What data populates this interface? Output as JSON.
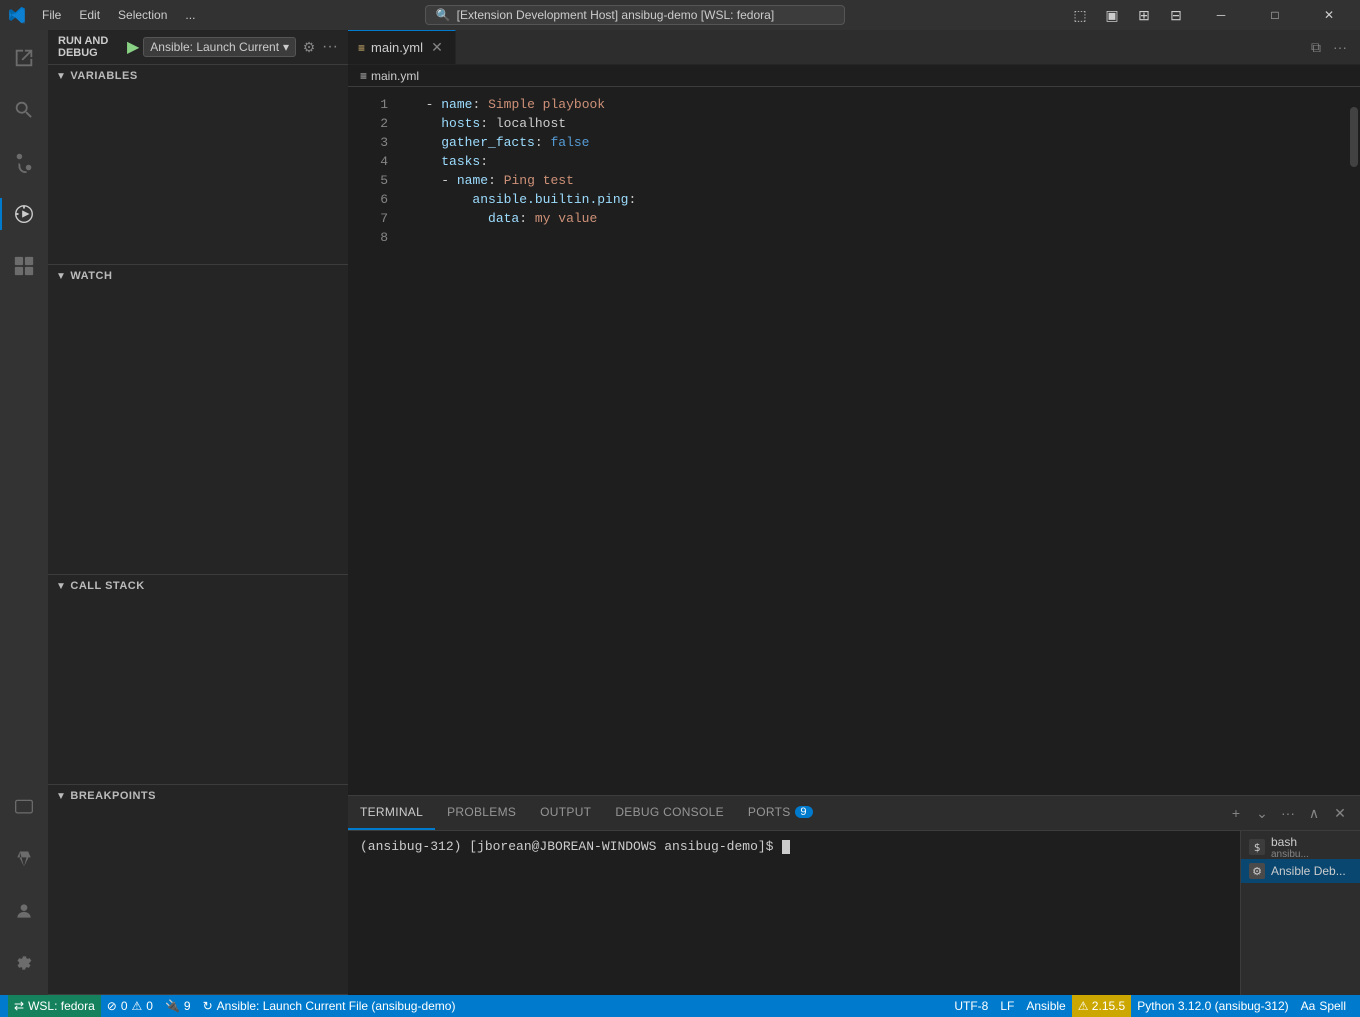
{
  "titlebar": {
    "menu_items": [
      "File",
      "Edit",
      "Selection",
      "..."
    ],
    "search_text": "[Extension Development Host] ansibug-demo [WSL: fedora]",
    "win_minimize": "─",
    "win_restore": "□",
    "win_close": "✕"
  },
  "activitybar": {
    "items": [
      {
        "name": "explorer",
        "icon": "⎘",
        "label": "Explorer"
      },
      {
        "name": "search",
        "icon": "🔍",
        "label": "Search"
      },
      {
        "name": "source-control",
        "icon": "⎇",
        "label": "Source Control"
      },
      {
        "name": "run-debug",
        "icon": "▶",
        "label": "Run and Debug",
        "active": true
      },
      {
        "name": "extensions",
        "icon": "⊞",
        "label": "Extensions"
      }
    ],
    "bottom_items": [
      {
        "name": "remote-explorer",
        "icon": "🖥",
        "label": "Remote Explorer"
      },
      {
        "name": "testing",
        "icon": "⚗",
        "label": "Testing"
      },
      {
        "name": "account",
        "icon": "A",
        "label": "Account"
      },
      {
        "name": "settings",
        "icon": "⚙",
        "label": "Settings"
      }
    ]
  },
  "sidebar": {
    "header": {
      "title": "RUN AND DEBUG",
      "run_icon": "▶",
      "config_label": "Ansible: Launch Current",
      "config_dropdown": "▾",
      "gear_icon": "⚙",
      "more_icon": "···"
    },
    "sections": {
      "variables": {
        "label": "VARIABLES",
        "expanded": true
      },
      "watch": {
        "label": "WATCH",
        "expanded": true
      },
      "call_stack": {
        "label": "CALL STACK",
        "expanded": true
      },
      "breakpoints": {
        "label": "BREAKPOINTS",
        "expanded": true
      }
    }
  },
  "editor": {
    "tab_icon": "≡",
    "tab_label": "main.yml",
    "tab_close": "✕",
    "breadcrumb_icon": "≡",
    "breadcrumb_label": "main.yml",
    "lines": [
      {
        "num": "1",
        "content": "  - name: Simple playbook"
      },
      {
        "num": "2",
        "content": "    hosts: localhost"
      },
      {
        "num": "3",
        "content": "    gather_facts: false"
      },
      {
        "num": "4",
        "content": "    tasks:"
      },
      {
        "num": "5",
        "content": "    - name: Ping test"
      },
      {
        "num": "6",
        "content": "        ansible.builtin.ping:"
      },
      {
        "num": "7",
        "content": "          data: my value"
      },
      {
        "num": "8",
        "content": ""
      }
    ]
  },
  "panel": {
    "tabs": [
      {
        "label": "TERMINAL",
        "active": true
      },
      {
        "label": "PROBLEMS",
        "active": false
      },
      {
        "label": "OUTPUT",
        "active": false
      },
      {
        "label": "DEBUG CONSOLE",
        "active": false
      },
      {
        "label": "PORTS",
        "active": false,
        "badge": "9"
      }
    ],
    "terminal_content": "(ansibug-312) [jborean@JBOREAN-WINDOWS ansibug-demo]$ ",
    "terminal_sessions": [
      {
        "label": "bash",
        "sublabel": "ansibu...",
        "icon": "$",
        "active": false
      },
      {
        "label": "Ansible Deb...",
        "sublabel": "",
        "icon": "⚙",
        "active": true
      }
    ]
  },
  "statusbar": {
    "wsl_label": "WSL: fedora",
    "errors": "0",
    "warnings": "0",
    "connections": "9",
    "launch_label": "Ansible: Launch Current File (ansibug-demo)",
    "encoding": "UTF-8",
    "line_ending": "LF",
    "language": "Ansible",
    "version_label": "⚠ 2.15.5",
    "python_label": "Python 3.12.0 (ansibug-312)",
    "spell_label": "Spell"
  }
}
